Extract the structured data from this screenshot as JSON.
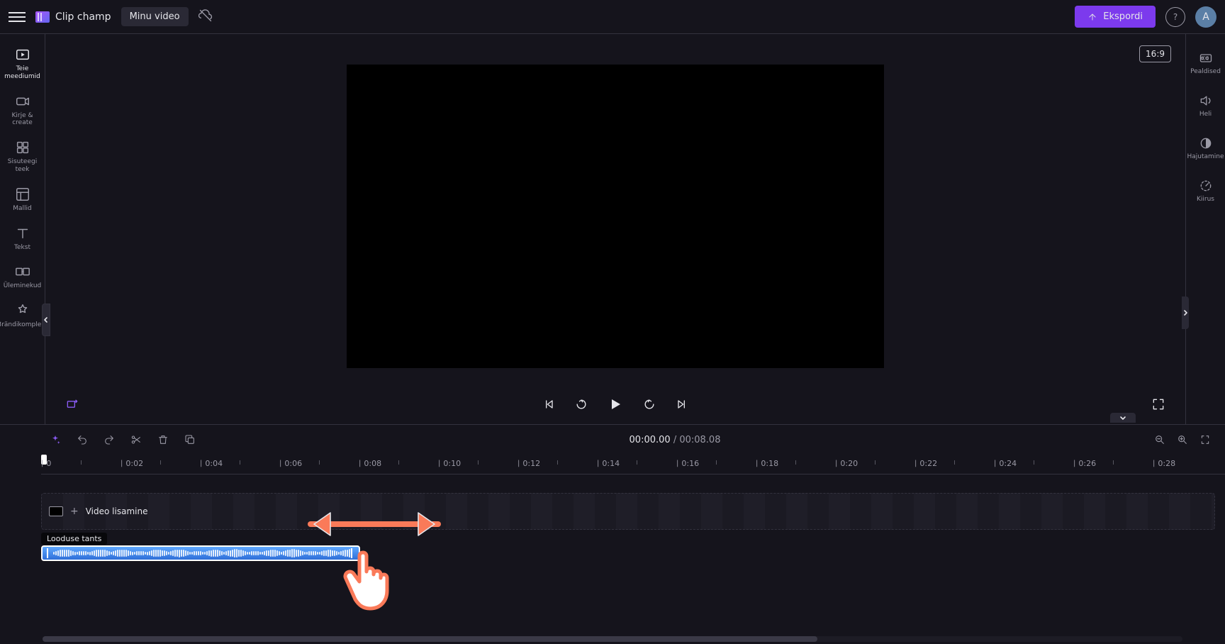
{
  "topbar": {
    "app_name": "Clip champ",
    "project_name": "Minu video",
    "export_label": "Ekspordi",
    "avatar_initial": "A"
  },
  "sidebar_left": {
    "items": [
      {
        "label": "Teie meediumid"
      },
      {
        "label": "Kirje &amp; create"
      },
      {
        "label": "Sisuteegi teek"
      },
      {
        "label": "Mallid"
      },
      {
        "label": "Tekst"
      },
      {
        "label": "Üleminekud"
      },
      {
        "label": "Brändikomplekt"
      }
    ]
  },
  "sidebar_right": {
    "items": [
      {
        "label": "Pealdised"
      },
      {
        "label": "Heli"
      },
      {
        "label": "Hajutamine"
      },
      {
        "label": "Kiirus"
      }
    ]
  },
  "preview": {
    "aspect_label": "16:9"
  },
  "timeline": {
    "current_time": "00:00.00",
    "duration": "00:08.08",
    "ruler_ticks": [
      "0",
      "0:02",
      "0:04",
      "0:06",
      "0:08",
      "0:10",
      "0:12",
      "0:14",
      "0:16",
      "0:18",
      "0:20",
      "0:22",
      "0:24",
      "0:26",
      "0:28"
    ],
    "video_track_label": "Video lisamine",
    "audio_track_name": "Looduse tants"
  }
}
